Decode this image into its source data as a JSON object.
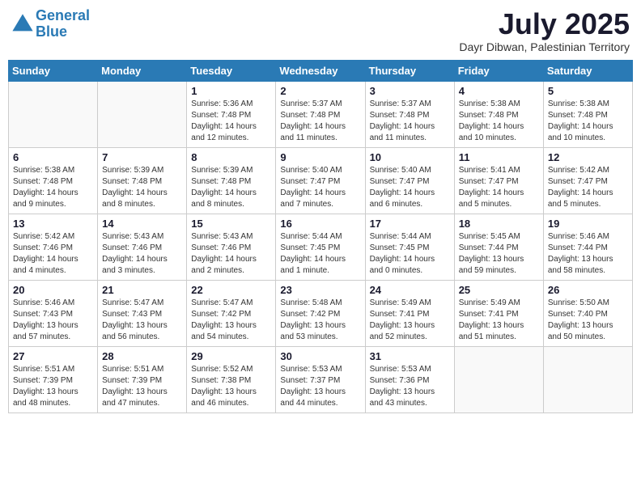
{
  "header": {
    "logo_line1": "General",
    "logo_line2": "Blue",
    "month_title": "July 2025",
    "location": "Dayr Dibwan, Palestinian Territory"
  },
  "weekdays": [
    "Sunday",
    "Monday",
    "Tuesday",
    "Wednesday",
    "Thursday",
    "Friday",
    "Saturday"
  ],
  "weeks": [
    [
      {
        "day": "",
        "info": ""
      },
      {
        "day": "",
        "info": ""
      },
      {
        "day": "1",
        "info": "Sunrise: 5:36 AM\nSunset: 7:48 PM\nDaylight: 14 hours\nand 12 minutes."
      },
      {
        "day": "2",
        "info": "Sunrise: 5:37 AM\nSunset: 7:48 PM\nDaylight: 14 hours\nand 11 minutes."
      },
      {
        "day": "3",
        "info": "Sunrise: 5:37 AM\nSunset: 7:48 PM\nDaylight: 14 hours\nand 11 minutes."
      },
      {
        "day": "4",
        "info": "Sunrise: 5:38 AM\nSunset: 7:48 PM\nDaylight: 14 hours\nand 10 minutes."
      },
      {
        "day": "5",
        "info": "Sunrise: 5:38 AM\nSunset: 7:48 PM\nDaylight: 14 hours\nand 10 minutes."
      }
    ],
    [
      {
        "day": "6",
        "info": "Sunrise: 5:38 AM\nSunset: 7:48 PM\nDaylight: 14 hours\nand 9 minutes."
      },
      {
        "day": "7",
        "info": "Sunrise: 5:39 AM\nSunset: 7:48 PM\nDaylight: 14 hours\nand 8 minutes."
      },
      {
        "day": "8",
        "info": "Sunrise: 5:39 AM\nSunset: 7:48 PM\nDaylight: 14 hours\nand 8 minutes."
      },
      {
        "day": "9",
        "info": "Sunrise: 5:40 AM\nSunset: 7:47 PM\nDaylight: 14 hours\nand 7 minutes."
      },
      {
        "day": "10",
        "info": "Sunrise: 5:40 AM\nSunset: 7:47 PM\nDaylight: 14 hours\nand 6 minutes."
      },
      {
        "day": "11",
        "info": "Sunrise: 5:41 AM\nSunset: 7:47 PM\nDaylight: 14 hours\nand 5 minutes."
      },
      {
        "day": "12",
        "info": "Sunrise: 5:42 AM\nSunset: 7:47 PM\nDaylight: 14 hours\nand 5 minutes."
      }
    ],
    [
      {
        "day": "13",
        "info": "Sunrise: 5:42 AM\nSunset: 7:46 PM\nDaylight: 14 hours\nand 4 minutes."
      },
      {
        "day": "14",
        "info": "Sunrise: 5:43 AM\nSunset: 7:46 PM\nDaylight: 14 hours\nand 3 minutes."
      },
      {
        "day": "15",
        "info": "Sunrise: 5:43 AM\nSunset: 7:46 PM\nDaylight: 14 hours\nand 2 minutes."
      },
      {
        "day": "16",
        "info": "Sunrise: 5:44 AM\nSunset: 7:45 PM\nDaylight: 14 hours\nand 1 minute."
      },
      {
        "day": "17",
        "info": "Sunrise: 5:44 AM\nSunset: 7:45 PM\nDaylight: 14 hours\nand 0 minutes."
      },
      {
        "day": "18",
        "info": "Sunrise: 5:45 AM\nSunset: 7:44 PM\nDaylight: 13 hours\nand 59 minutes."
      },
      {
        "day": "19",
        "info": "Sunrise: 5:46 AM\nSunset: 7:44 PM\nDaylight: 13 hours\nand 58 minutes."
      }
    ],
    [
      {
        "day": "20",
        "info": "Sunrise: 5:46 AM\nSunset: 7:43 PM\nDaylight: 13 hours\nand 57 minutes."
      },
      {
        "day": "21",
        "info": "Sunrise: 5:47 AM\nSunset: 7:43 PM\nDaylight: 13 hours\nand 56 minutes."
      },
      {
        "day": "22",
        "info": "Sunrise: 5:47 AM\nSunset: 7:42 PM\nDaylight: 13 hours\nand 54 minutes."
      },
      {
        "day": "23",
        "info": "Sunrise: 5:48 AM\nSunset: 7:42 PM\nDaylight: 13 hours\nand 53 minutes."
      },
      {
        "day": "24",
        "info": "Sunrise: 5:49 AM\nSunset: 7:41 PM\nDaylight: 13 hours\nand 52 minutes."
      },
      {
        "day": "25",
        "info": "Sunrise: 5:49 AM\nSunset: 7:41 PM\nDaylight: 13 hours\nand 51 minutes."
      },
      {
        "day": "26",
        "info": "Sunrise: 5:50 AM\nSunset: 7:40 PM\nDaylight: 13 hours\nand 50 minutes."
      }
    ],
    [
      {
        "day": "27",
        "info": "Sunrise: 5:51 AM\nSunset: 7:39 PM\nDaylight: 13 hours\nand 48 minutes."
      },
      {
        "day": "28",
        "info": "Sunrise: 5:51 AM\nSunset: 7:39 PM\nDaylight: 13 hours\nand 47 minutes."
      },
      {
        "day": "29",
        "info": "Sunrise: 5:52 AM\nSunset: 7:38 PM\nDaylight: 13 hours\nand 46 minutes."
      },
      {
        "day": "30",
        "info": "Sunrise: 5:53 AM\nSunset: 7:37 PM\nDaylight: 13 hours\nand 44 minutes."
      },
      {
        "day": "31",
        "info": "Sunrise: 5:53 AM\nSunset: 7:36 PM\nDaylight: 13 hours\nand 43 minutes."
      },
      {
        "day": "",
        "info": ""
      },
      {
        "day": "",
        "info": ""
      }
    ]
  ]
}
